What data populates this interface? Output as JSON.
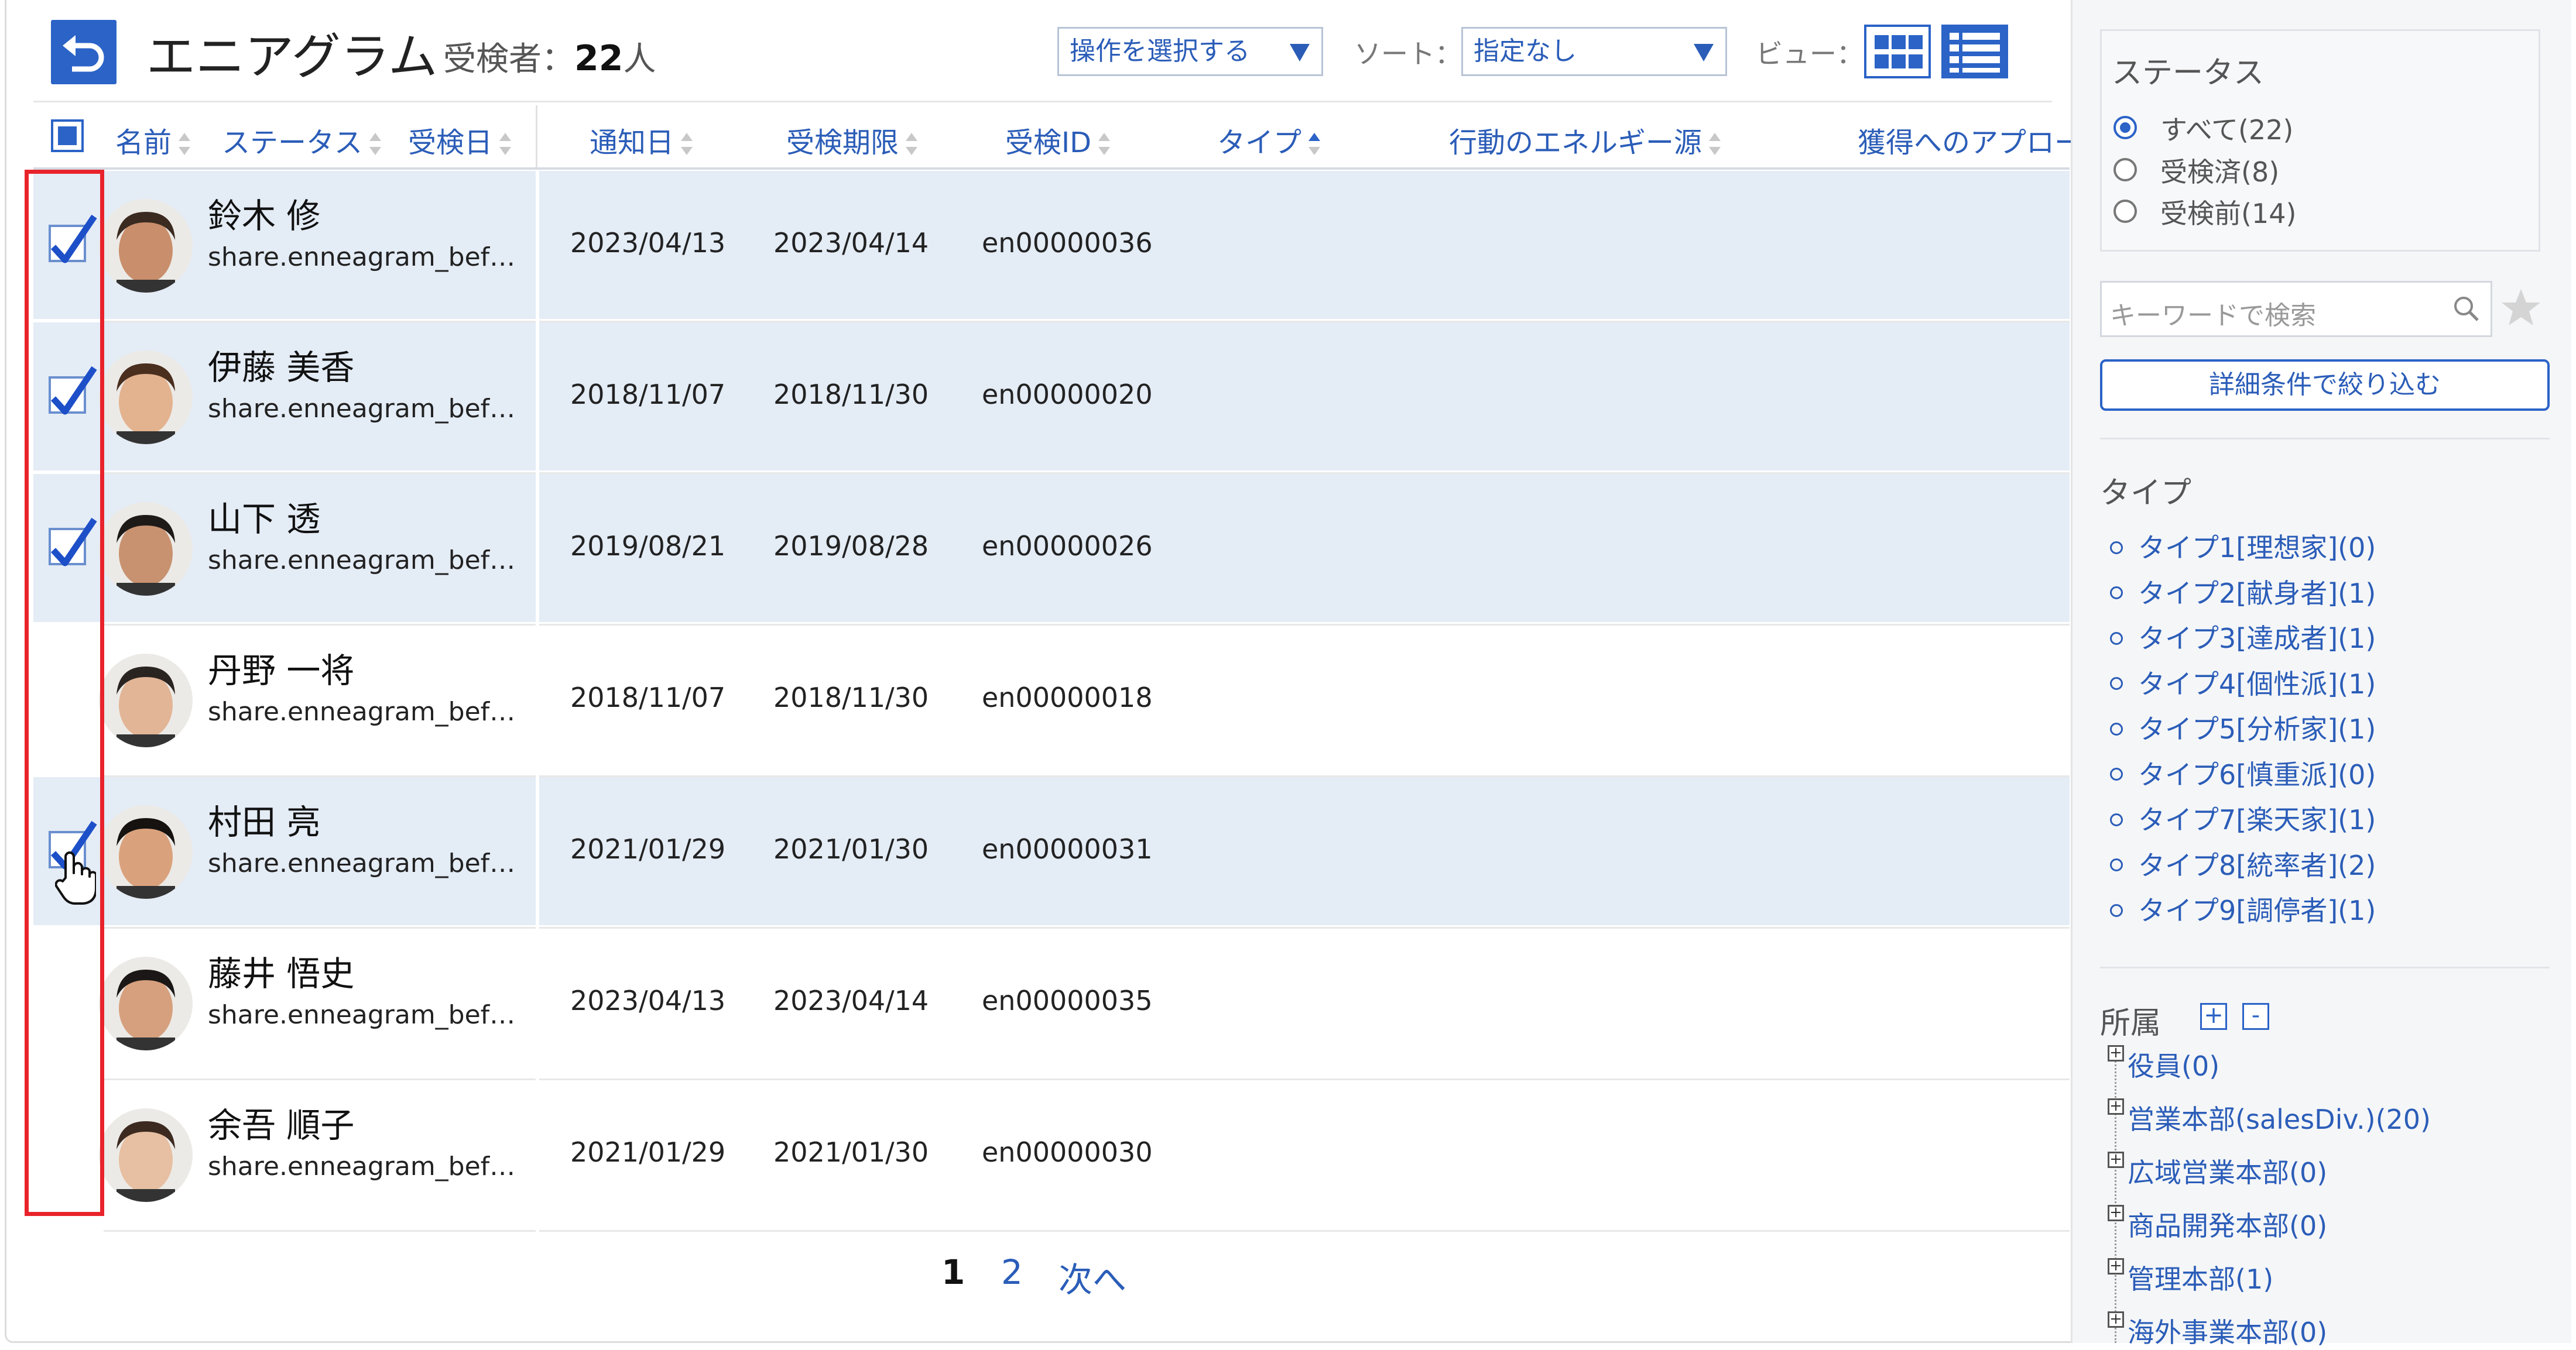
{
  "header": {
    "title": "エニアグラム",
    "examinees_label": "受検者：",
    "examinees_count": "22",
    "examinees_unit": "人",
    "action_select": "操作を選択する",
    "sort_label": "ソート：",
    "sort_select": "指定なし",
    "view_label": "ビュー：",
    "view_mode": "list"
  },
  "table": {
    "columns": [
      "名前",
      "ステータス",
      "受検日",
      "通知日",
      "受検期限",
      "受検ID",
      "タイプ",
      "行動のエネルギー源",
      "獲得へのアプロー"
    ],
    "rows": [
      {
        "name": "鈴木 修",
        "email": "share.enneagram_bef…",
        "notified": "2023/04/13",
        "deadline": "2023/04/14",
        "exam_id": "en00000036",
        "checked": true
      },
      {
        "name": "伊藤 美香",
        "email": "share.enneagram_bef…",
        "notified": "2018/11/07",
        "deadline": "2018/11/30",
        "exam_id": "en00000020",
        "checked": true
      },
      {
        "name": "山下 透",
        "email": "share.enneagram_bef…",
        "notified": "2019/08/21",
        "deadline": "2019/08/28",
        "exam_id": "en00000026",
        "checked": true
      },
      {
        "name": "丹野 一将",
        "email": "share.enneagram_bef…",
        "notified": "2018/11/07",
        "deadline": "2018/11/30",
        "exam_id": "en00000018",
        "checked": false
      },
      {
        "name": "村田 亮",
        "email": "share.enneagram_bef…",
        "notified": "2021/01/29",
        "deadline": "2021/01/30",
        "exam_id": "en00000031",
        "checked": true
      },
      {
        "name": "藤井 悟史",
        "email": "share.enneagram_bef…",
        "notified": "2023/04/13",
        "deadline": "2023/04/14",
        "exam_id": "en00000035",
        "checked": false
      },
      {
        "name": "余吾 順子",
        "email": "share.enneagram_bef…",
        "notified": "2021/01/29",
        "deadline": "2021/01/30",
        "exam_id": "en00000030",
        "checked": false
      }
    ]
  },
  "pagination": {
    "current": "1",
    "page2": "2",
    "next": "次へ"
  },
  "sidebar": {
    "status_title": "ステータス",
    "status_options": [
      "すべて(22)",
      "受検済(8)",
      "受検前(14)"
    ],
    "status_selected": 0,
    "search_placeholder": "キーワードで検索",
    "refine_button": "詳細条件で絞り込む",
    "type_title": "タイプ",
    "types": [
      "タイプ1[理想家](0)",
      "タイプ2[献身者](1)",
      "タイプ3[達成者](1)",
      "タイプ4[個性派](1)",
      "タイプ5[分析家](1)",
      "タイプ6[慎重派](0)",
      "タイプ7[楽天家](1)",
      "タイプ8[統率者](2)",
      "タイプ9[調停者](1)"
    ],
    "dept_title": "所属",
    "dept_expand": "+",
    "dept_collapse": "-",
    "departments": [
      "役員(0)",
      "営業本部(salesDiv.)(20)",
      "広域営業本部(0)",
      "商品開発本部(0)",
      "管理本部(1)",
      "海外事業本部(0)"
    ]
  },
  "colors": {
    "accent": "#2b63c7",
    "link": "#2b5db8",
    "selected_row": "#e4ecf6",
    "highlight": "#e8232b"
  }
}
